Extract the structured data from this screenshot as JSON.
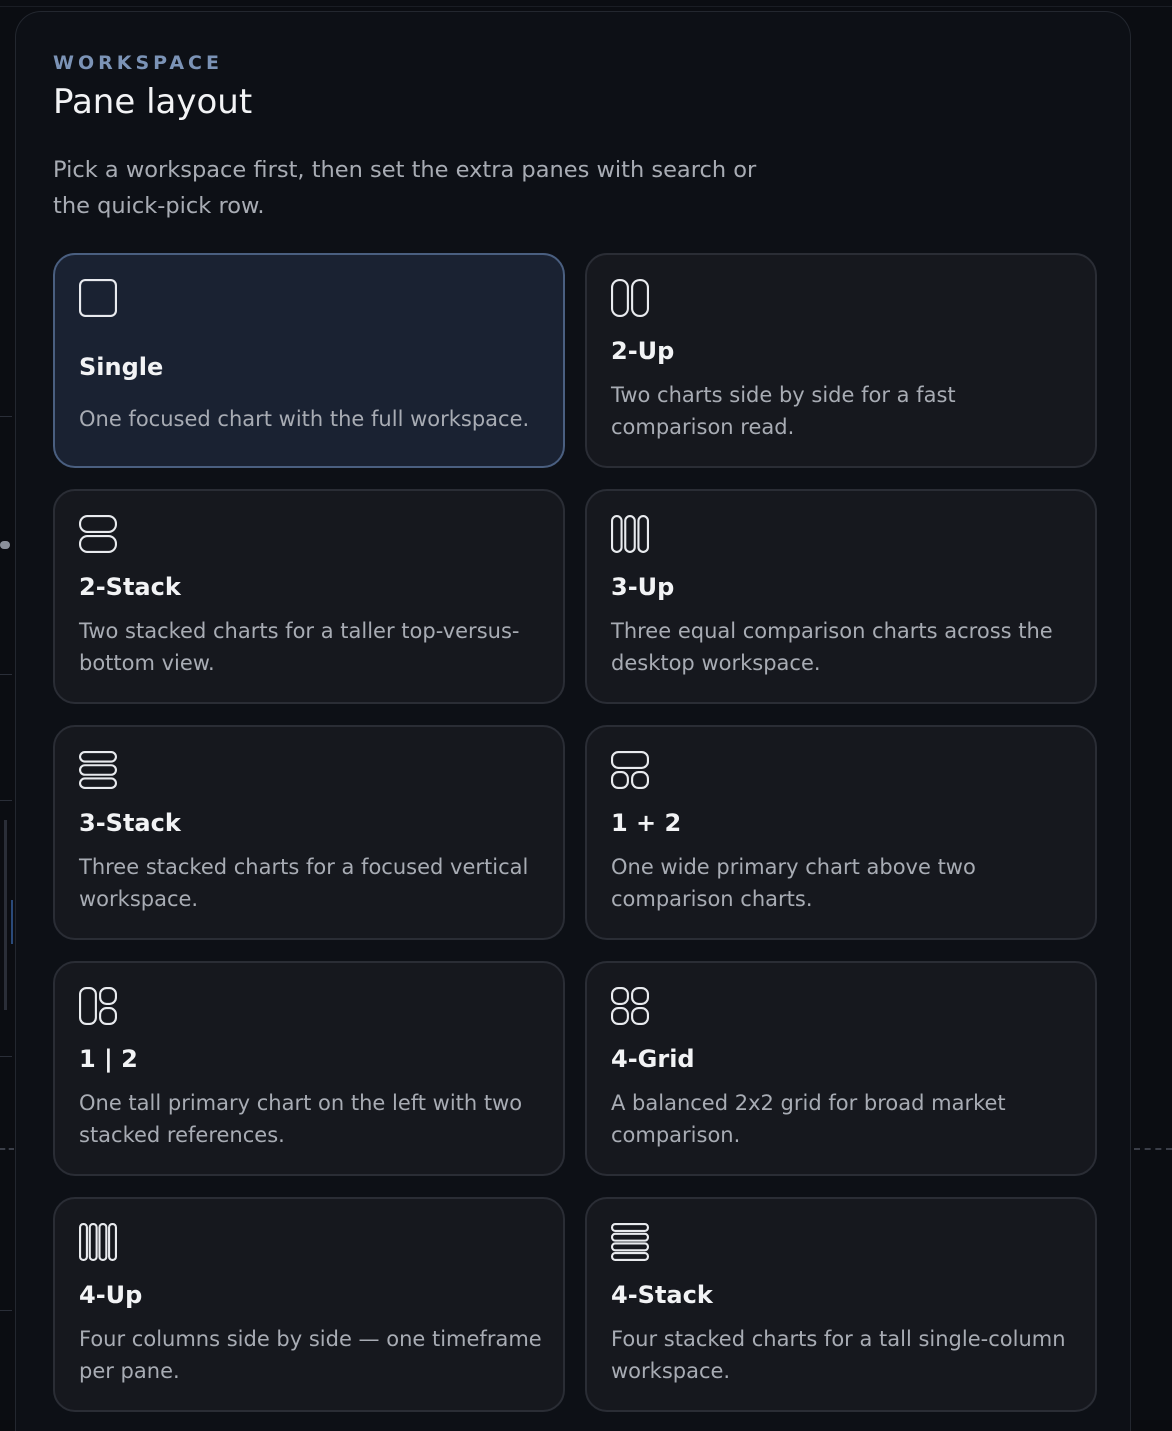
{
  "header": {
    "eyebrow": "WORKSPACE",
    "title": "Pane layout",
    "description": "Pick a workspace first, then set the extra panes with search or the quick-pick row."
  },
  "layouts": [
    {
      "label": "Single",
      "description": "One focused chart with the full workspace.",
      "icon": "single-pane-icon",
      "selected": true
    },
    {
      "label": "2-Up",
      "description": "Two charts side by side for a fast comparison read.",
      "icon": "two-columns-icon",
      "selected": false
    },
    {
      "label": "2-Stack",
      "description": "Two stacked charts for a taller top-versus-bottom view.",
      "icon": "two-rows-icon",
      "selected": false
    },
    {
      "label": "3-Up",
      "description": "Three equal comparison charts across the desktop workspace.",
      "icon": "three-columns-icon",
      "selected": false
    },
    {
      "label": "3-Stack",
      "description": "Three stacked charts for a focused vertical workspace.",
      "icon": "three-rows-icon",
      "selected": false
    },
    {
      "label": "1 + 2",
      "description": "One wide primary chart above two comparison charts.",
      "icon": "one-over-two-icon",
      "selected": false
    },
    {
      "label": "1 | 2",
      "description": "One tall primary chart on the left with two stacked references.",
      "icon": "one-beside-two-icon",
      "selected": false
    },
    {
      "label": "4-Grid",
      "description": "A balanced 2x2 grid for broad market comparison.",
      "icon": "four-grid-icon",
      "selected": false
    },
    {
      "label": "4-Up",
      "description": "Four columns side by side — one timeframe per pane.",
      "icon": "four-columns-icon",
      "selected": false
    },
    {
      "label": "4-Stack",
      "description": "Four stacked charts for a tall single-column workspace.",
      "icon": "four-rows-icon",
      "selected": false
    }
  ],
  "colors": {
    "accent": "#7b93b6",
    "selected_background": "#1a2232",
    "selected_border": "#4a5f80",
    "card_background": "#16181e",
    "icon_stroke": "#e8eaee"
  }
}
